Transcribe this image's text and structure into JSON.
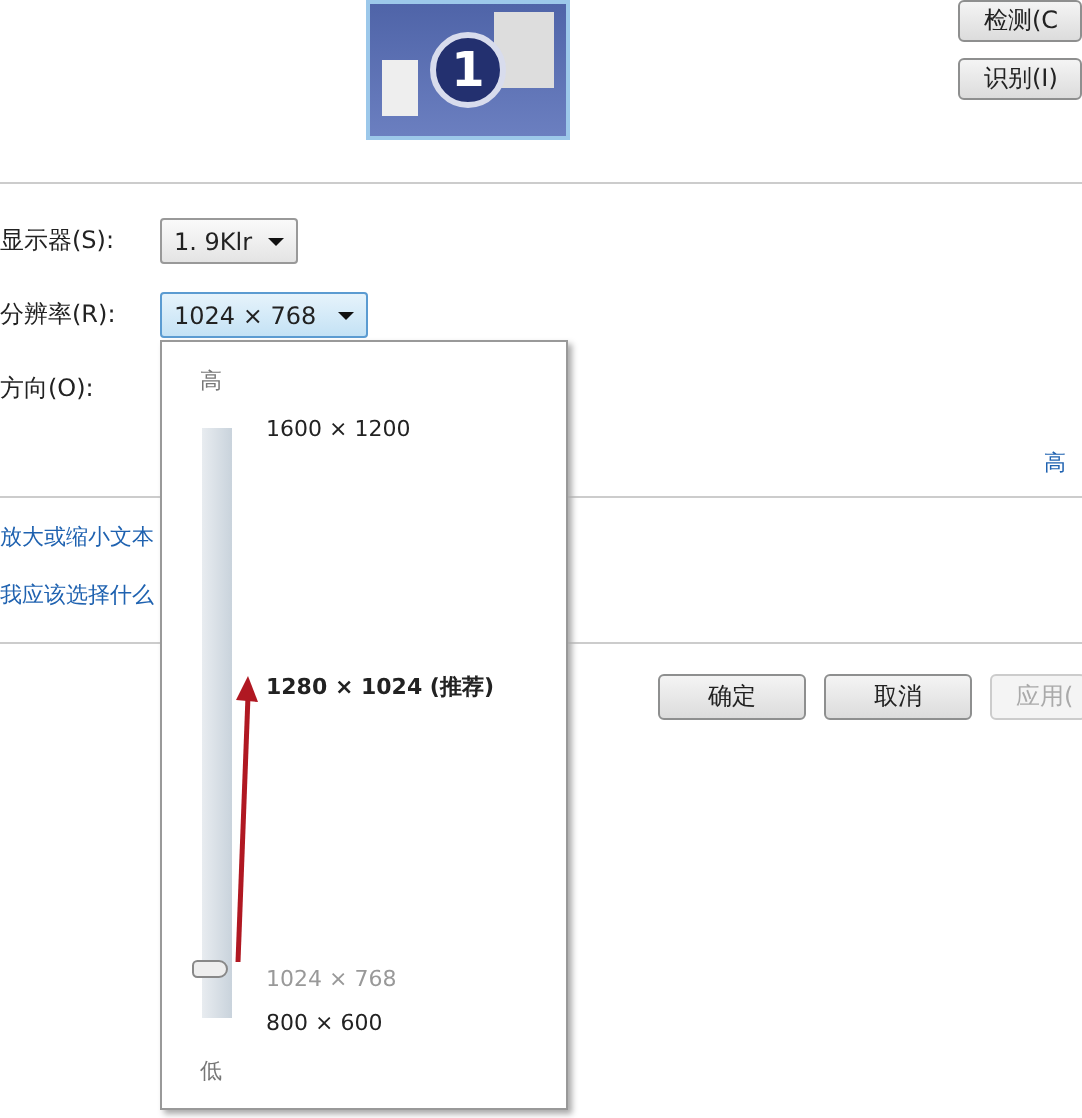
{
  "monitor": {
    "number": "1"
  },
  "side_buttons": [
    "检测(C",
    "识别(I)"
  ],
  "fields": [
    {
      "label": "显示器(S):",
      "value": "1. 9Klr",
      "focused": false
    },
    {
      "label": "分辨率(R):",
      "value": "1024 × 768",
      "focused": true
    },
    {
      "label": "方向(O):"
    }
  ],
  "advanced_link": "高",
  "links": [
    "放大或缩小文本",
    "我应该选择什么"
  ],
  "buttons": [
    {
      "label": "确定",
      "disabled": false
    },
    {
      "label": "取消",
      "disabled": false
    },
    {
      "label": "应用(",
      "disabled": true
    }
  ],
  "resolution_popup": {
    "high_label": "高",
    "low_label": "低",
    "level": 0.07,
    "options": [
      {
        "label": "1600 × 1200",
        "kind": "normal"
      },
      {
        "label": "1280 × 1024 (推荐)",
        "kind": "recommended"
      },
      {
        "label": "1024 × 768",
        "kind": "current"
      },
      {
        "label": "800 × 600",
        "kind": "normal"
      }
    ]
  }
}
